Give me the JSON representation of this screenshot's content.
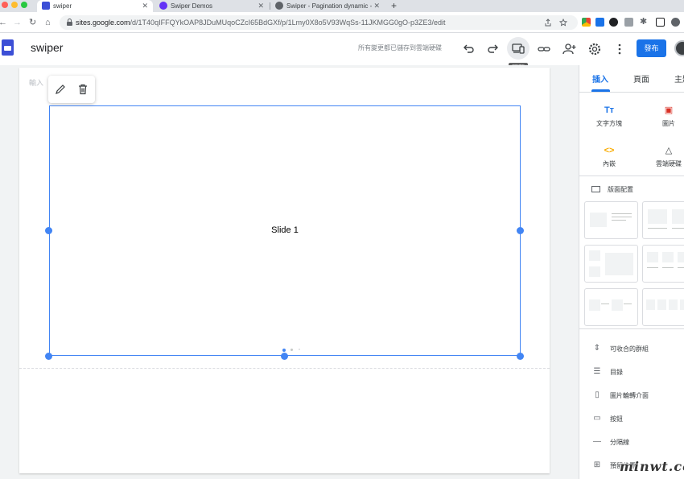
{
  "browser": {
    "tabs": [
      {
        "title": "swiper",
        "active": true
      },
      {
        "title": "Swiper Demos",
        "active": false
      },
      {
        "title": "Swiper - Pagination dynamic -",
        "active": false
      }
    ],
    "url_host": "sites.google.com",
    "url_path": "/d/1T40qIFFQYkOAP8JDuMUqoCZcI65BdGXf/p/1Lmy0X8o5V93WqSs-11JKMGG0gO-p3ZE3/edit"
  },
  "header": {
    "site_name": "swiper",
    "save_status": "所有變更都已儲存到雲端硬碟",
    "preview_tooltip": "預覽",
    "publish_label": "發布"
  },
  "canvas": {
    "ghost_text": "輸入",
    "slide_text": "Slide 1",
    "pagination": {
      "count": 3,
      "active_index": 0
    }
  },
  "sidebar": {
    "tabs": [
      "插入",
      "頁面",
      "主題"
    ],
    "insert_tiles": [
      {
        "label": "文字方塊",
        "icon": "text-box-icon",
        "glyph": "Tт",
        "color": "#1a73e8"
      },
      {
        "label": "圖片",
        "icon": "image-icon",
        "glyph": "▣",
        "color": "#d93025"
      },
      {
        "label": "內嵌",
        "icon": "embed-icon",
        "glyph": "<>",
        "color": "#f9ab00"
      },
      {
        "label": "雲端硬碟",
        "icon": "drive-icon",
        "glyph": "△",
        "color": "#3c4043"
      }
    ],
    "layouts_heading": "版面配置",
    "list_items": [
      {
        "label": "可收合的群組",
        "icon": "collapsible-group-icon",
        "glyph": "⇕"
      },
      {
        "label": "目錄",
        "icon": "table-of-contents-icon",
        "glyph": "☰"
      },
      {
        "label": "圖片輪轉介面",
        "icon": "image-carousel-icon",
        "glyph": "▯"
      },
      {
        "label": "按鈕",
        "icon": "button-icon",
        "glyph": "▭"
      },
      {
        "label": "分隔線",
        "icon": "divider-icon",
        "glyph": "—"
      },
      {
        "label": "預留位置",
        "icon": "placeholder-icon",
        "glyph": "⊞"
      }
    ]
  },
  "watermark": "minwt.com",
  "colors": {
    "accent": "#1a73e8",
    "selection": "#4285f4",
    "workspace": "#f1f3f4"
  }
}
